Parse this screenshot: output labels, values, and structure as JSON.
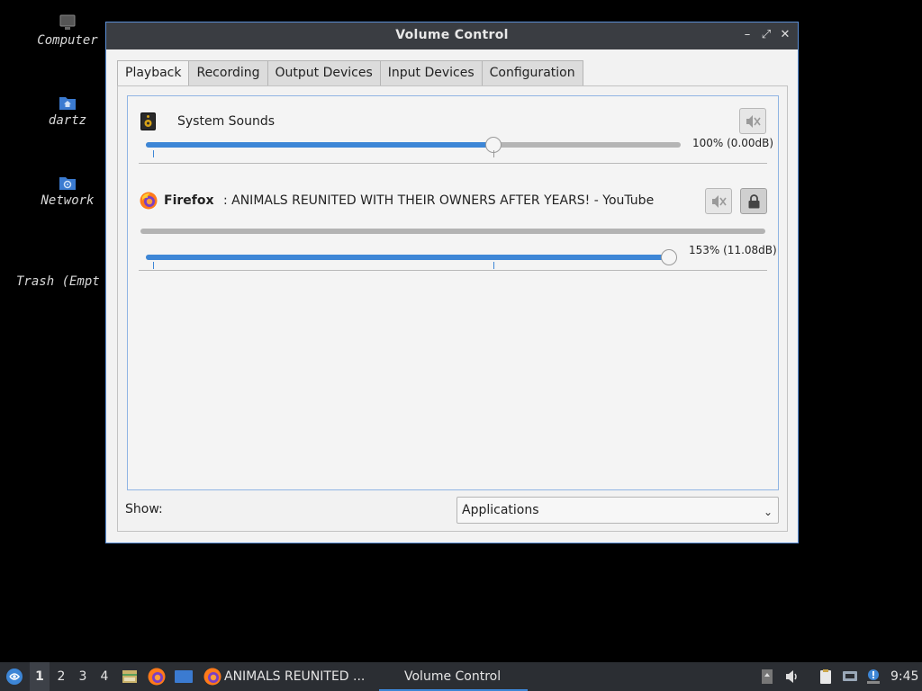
{
  "desktop": {
    "icons": [
      {
        "label": "Computer",
        "icon": "computer-icon"
      },
      {
        "label": "dartz",
        "icon": "home-folder-icon"
      },
      {
        "label": "Network",
        "icon": "network-folder-icon"
      },
      {
        "label": "Trash (Empt",
        "icon": "trash-icon"
      }
    ]
  },
  "window": {
    "title": "Volume Control",
    "controls": {
      "minimize": "–",
      "maximize": "⤢",
      "close": "✕"
    },
    "tabs": [
      {
        "label": "Playback",
        "active": true
      },
      {
        "label": "Recording",
        "active": false
      },
      {
        "label": "Output Devices",
        "active": false
      },
      {
        "label": "Input Devices",
        "active": false
      },
      {
        "label": "Configuration",
        "active": false
      }
    ],
    "streams": [
      {
        "app": "System Sounds",
        "icon": "speaker-icon",
        "volume_label": "100% (0.00dB)",
        "volume_fraction": 0.65,
        "muted": false
      },
      {
        "app": "Firefox",
        "media": ": ANIMALS REUNITED WITH THEIR OWNERS AFTER YEARS! - YouTube",
        "icon": "firefox-icon",
        "volume_label": "153% (11.08dB)",
        "volume_fraction": 0.99,
        "muted": false,
        "locked": true
      }
    ],
    "show": {
      "label": "Show:",
      "value": "Applications"
    }
  },
  "taskbar": {
    "workspaces": [
      "1",
      "2",
      "3",
      "4"
    ],
    "active_workspace": "1",
    "tasks": [
      {
        "label": "ANIMALS REUNITED ...",
        "icon": "firefox-icon",
        "active": false
      },
      {
        "label": "Volume Control",
        "active": true
      }
    ],
    "clock": "9:45"
  },
  "colors": {
    "accent": "#3d86d6",
    "titlebar": "#3a3d42",
    "taskbar": "#2b2e33"
  }
}
